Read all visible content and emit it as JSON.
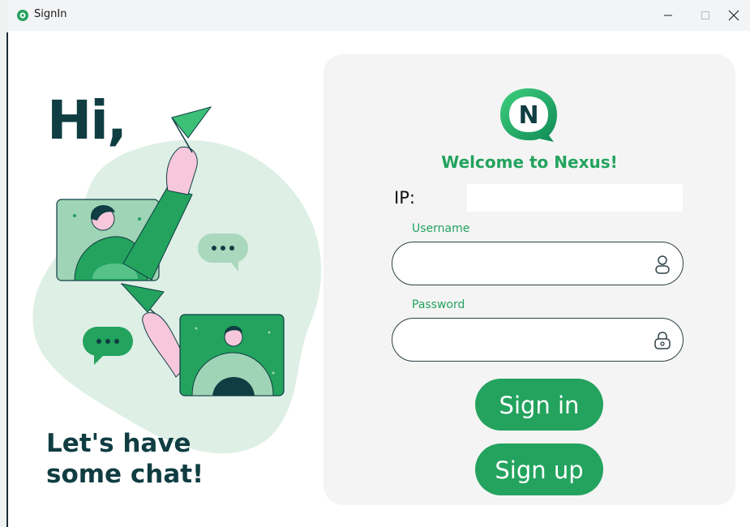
{
  "window": {
    "title": "SignIn"
  },
  "hero": {
    "greeting": "Hi,",
    "tagline": "Let's have\nsome chat!"
  },
  "form": {
    "logo_letter": "N",
    "welcome": "Welcome to Nexus!",
    "ip_label": "IP:",
    "ip_value": "",
    "username_label": "Username",
    "username_value": "",
    "password_label": "Password",
    "password_value": "",
    "signin_label": "Sign in",
    "signup_label": "Sign up"
  },
  "icons": {
    "user": "user-icon",
    "lock": "lock-icon",
    "app": "nexus-logo-icon"
  },
  "colors": {
    "brand_green": "#23a35e",
    "dark_teal": "#0f3d42",
    "card_bg": "#f4f4f4",
    "blob": "#deefe6"
  }
}
